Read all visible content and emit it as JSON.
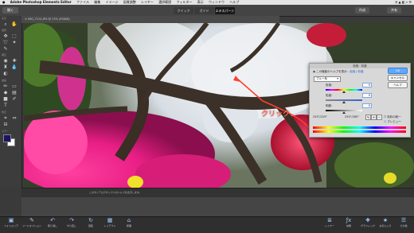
{
  "menubar": {
    "apple": "",
    "app": "Adobe Photoshop Elements Editor",
    "items": [
      "ファイル",
      "編集",
      "イメージ",
      "画質調整",
      "レイヤー",
      "選択範囲",
      "フィルター",
      "表示",
      "ウィンドウ",
      "ヘルプ"
    ]
  },
  "topbar": {
    "open_label": "開く",
    "modes": [
      "クイック",
      "ガイド",
      "エキスパート"
    ],
    "active_mode": "エキスパート",
    "create_label": "作成",
    "share_label": "共有"
  },
  "document_tab": {
    "title": "IMG_7124.JPG @ 23% (RGB/8)"
  },
  "toolbox": {
    "section_labels": [
      "表示",
      "選択",
      "補正",
      "描画",
      "修正",
      "カラー"
    ],
    "foreground_color": "#1b1560",
    "background_color": "#ffffff"
  },
  "dialog": {
    "title": "色相・彩度",
    "help_line": "この機能のヘルプを表示：",
    "help_link_1": "色相",
    "help_link_2": "彩度",
    "ok_label": "OK",
    "cancel_label": "キャンセル",
    "help_label": "ヘルプ",
    "channel_select": "ブルー系",
    "hue_label": "色相：",
    "hue_value": "0",
    "saturation_label": "彩度：",
    "saturation_value": "0",
    "lightness_label": "明度：",
    "lightness_value": "0",
    "range_left": "255°/225°",
    "range_right": "255°/285°",
    "colorize_label": "色彩の統一",
    "preview_label": "プレビュー",
    "hue_position": 0.5,
    "saturation_position": 0.5,
    "lightness_position": 0.5
  },
  "annotation": {
    "callout_text": "クリック",
    "color": "#ff6a5a"
  },
  "statusbar": {
    "hint_text": "このダイアログボックスのヘルプを表示します。"
  },
  "bottombar": {
    "left_items": [
      {
        "icon": "photo-bin-icon",
        "label": "フォトエリア"
      },
      {
        "icon": "tool-options-icon",
        "label": "ツールオプション"
      },
      {
        "icon": "undo-icon",
        "label": "取り消し"
      },
      {
        "icon": "redo-icon",
        "label": "やり直し"
      },
      {
        "icon": "rotate-icon",
        "label": "回転"
      },
      {
        "icon": "layout-icon",
        "label": "レイアウト"
      },
      {
        "icon": "organizer-icon",
        "label": "整理"
      }
    ],
    "right_items": [
      {
        "icon": "layers-icon",
        "label": "レイヤー"
      },
      {
        "icon": "effects-icon",
        "label": "効果"
      },
      {
        "icon": "graphics-icon",
        "label": "グラフィック"
      },
      {
        "icon": "favorites-icon",
        "label": "お気に入り"
      },
      {
        "icon": "more-icon",
        "label": "その他"
      }
    ]
  },
  "colors": {
    "accent": "#5fa8ff",
    "brand": "#2c5aa0"
  }
}
